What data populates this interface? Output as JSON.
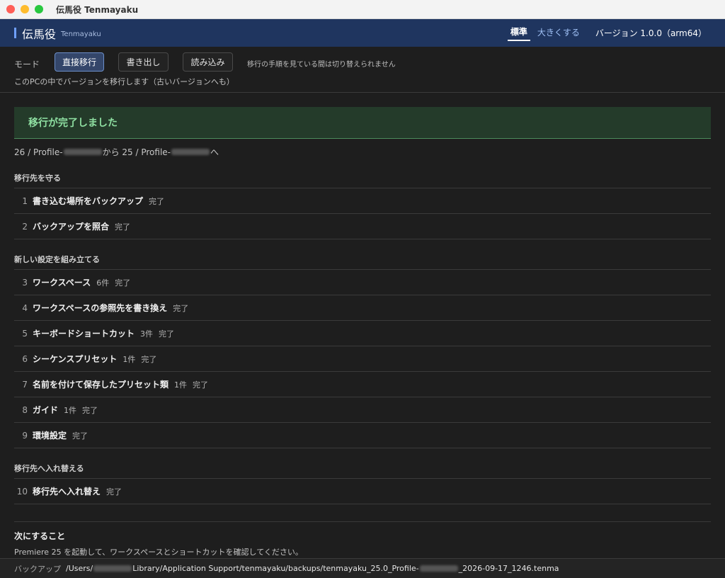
{
  "window": {
    "title": "伝馬役 Tenmayaku"
  },
  "header": {
    "brand": "伝馬役",
    "brand_sub": "Tenmayaku",
    "size_standard": "標準",
    "size_large": "大きくする",
    "version": "バージョン 1.0.0（arm64）"
  },
  "mode": {
    "label": "モード",
    "buttons": [
      "直接移行",
      "書き出し",
      "読み込み"
    ],
    "active": "直接移行",
    "note": "移行の手順を見ている間は切り替えられません",
    "description": "このPCの中でバージョンを移行します（古いバージョンへも）"
  },
  "banner": {
    "title": "移行が完了しました"
  },
  "route": {
    "from_prefix": "26 / Profile-",
    "middle": "から 25 / Profile-",
    "suffix": " へ"
  },
  "sections": [
    {
      "title": "移行先を守る",
      "steps": [
        {
          "num": "1",
          "name": "書き込む場所をバックアップ",
          "count": "",
          "status": "完了"
        },
        {
          "num": "2",
          "name": "バックアップを照合",
          "count": "",
          "status": "完了"
        }
      ]
    },
    {
      "title": "新しい設定を組み立てる",
      "steps": [
        {
          "num": "3",
          "name": "ワークスペース",
          "count": "6件",
          "status": "完了"
        },
        {
          "num": "4",
          "name": "ワークスペースの参照先を書き換え",
          "count": "",
          "status": "完了"
        },
        {
          "num": "5",
          "name": "キーボードショートカット",
          "count": "3件",
          "status": "完了"
        },
        {
          "num": "6",
          "name": "シーケンスプリセット",
          "count": "1件",
          "status": "完了"
        },
        {
          "num": "7",
          "name": "名前を付けて保存したプリセット類",
          "count": "1件",
          "status": "完了"
        },
        {
          "num": "8",
          "name": "ガイド",
          "count": "1件",
          "status": "完了"
        },
        {
          "num": "9",
          "name": "環境設定",
          "count": "",
          "status": "完了"
        }
      ]
    },
    {
      "title": "移行先へ入れ替える",
      "steps": [
        {
          "num": "10",
          "name": "移行先へ入れ替え",
          "count": "",
          "status": "完了"
        }
      ]
    }
  ],
  "next": {
    "title": "次にすること",
    "text": "Premiere 25 を起動して、ワークスペースとショートカットを確認してください。"
  },
  "footer": {
    "label": "バックアップ",
    "path_prefix": "/Users/",
    "path_middle": "Library/Application Support/tenmayaku/backups/tenmayaku_25.0_Profile-",
    "path_suffix": "_2026-09-17_1246.tenma"
  }
}
